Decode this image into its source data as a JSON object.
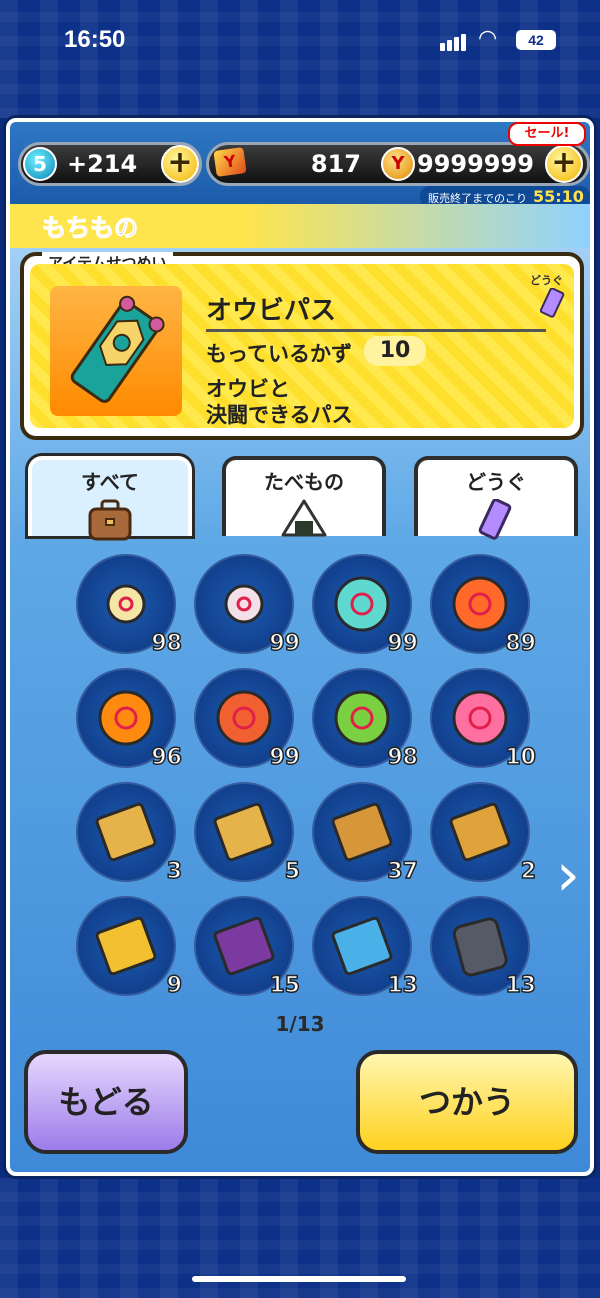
{
  "status_bar": {
    "time": "16:50",
    "battery": "42"
  },
  "currency": {
    "level": "5",
    "level_amount": "+214",
    "tickets": "817",
    "coins": "9999999",
    "sale_badge": "セール!",
    "sale_timer_label": "販売終了までのこり",
    "sale_timer_value": "55:10"
  },
  "section_title": "もちもの",
  "description": {
    "label": "アイテムせつめい",
    "category_tag": "どうぐ",
    "item_name": "オウビパス",
    "count_label": "もっているかず",
    "count_value": "10",
    "text_line1": "オウビと",
    "text_line2": "決闘できるパス"
  },
  "tabs": [
    {
      "label": "すべて",
      "icon": "bag-icon",
      "active": true
    },
    {
      "label": "たべもの",
      "icon": "onigiri-icon",
      "active": false
    },
    {
      "label": "どうぐ",
      "icon": "ticket-icon",
      "active": false
    }
  ],
  "items": [
    {
      "name": "small-orb-1",
      "qty": "98",
      "color": "#f5e6a8"
    },
    {
      "name": "small-orb-2",
      "qty": "99",
      "color": "#f4e0e8"
    },
    {
      "name": "swirl-orb-cyan",
      "qty": "99",
      "color": "#5fd8d0"
    },
    {
      "name": "swirl-orb-orange",
      "qty": "89",
      "color": "#ff6a2a"
    },
    {
      "name": "flame-orb",
      "qty": "96",
      "color": "#ff8a10"
    },
    {
      "name": "orb-on-stand",
      "qty": "99",
      "color": "#f06030"
    },
    {
      "name": "rainbow-orb-gold",
      "qty": "98",
      "color": "#7ad040"
    },
    {
      "name": "rainbow-orb-deluxe",
      "qty": "10",
      "color": "#ff70a0"
    },
    {
      "name": "book-1",
      "qty": "3",
      "color": "#e6b24a"
    },
    {
      "name": "book-2",
      "qty": "5",
      "color": "#e6b24a"
    },
    {
      "name": "book-3",
      "qty": "37",
      "color": "#d8963a"
    },
    {
      "name": "book-4",
      "qty": "2",
      "color": "#e0a23a"
    },
    {
      "name": "book-deluxe",
      "qty": "9",
      "color": "#f2c030"
    },
    {
      "name": "book-purple",
      "qty": "15",
      "color": "#7a3aa0"
    },
    {
      "name": "book-blue",
      "qty": "13",
      "color": "#4ab0e8"
    },
    {
      "name": "stone-tablet",
      "qty": "13",
      "color": "#555a66"
    }
  ],
  "pagination": "1/13",
  "buttons": {
    "back": "もどる",
    "use": "つかう"
  }
}
